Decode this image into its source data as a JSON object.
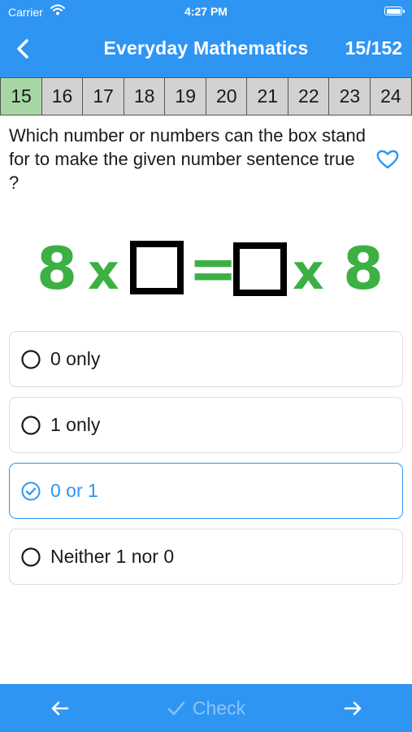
{
  "status_bar": {
    "carrier": "Carrier",
    "time": "4:27 PM"
  },
  "nav": {
    "title": "Everyday Mathematics",
    "counter": "15/152"
  },
  "question_strip": {
    "numbers": [
      "15",
      "16",
      "17",
      "18",
      "19",
      "20",
      "21",
      "22",
      "23",
      "24"
    ],
    "current": "15"
  },
  "question": {
    "text": "Which number or numbers can the box stand for to make the given number sentence true ?"
  },
  "equation": {
    "left_number": "8",
    "times": "x",
    "equals": "=",
    "right_times": "x",
    "right_number": "8"
  },
  "options": [
    {
      "label": "0 only",
      "selected": false
    },
    {
      "label": "1 only",
      "selected": false
    },
    {
      "label": "0 or 1",
      "selected": true
    },
    {
      "label": "Neither 1 nor 0",
      "selected": false
    }
  ],
  "footer": {
    "check_label": "Check"
  },
  "colors": {
    "accent": "#2f95f3",
    "current_question": "#a7d6a2",
    "question_cell": "#d2d2d2",
    "equation_green": "#3cb043",
    "check_disabled": "#8ec4f7"
  },
  "icons": {
    "back": "chevron-left-icon",
    "favorite": "heart-outline-icon",
    "radio": "radio-empty-icon",
    "radio_selected": "radio-checked-icon",
    "prev": "arrow-left-icon",
    "next": "arrow-right-icon",
    "check": "checkmark-icon"
  }
}
